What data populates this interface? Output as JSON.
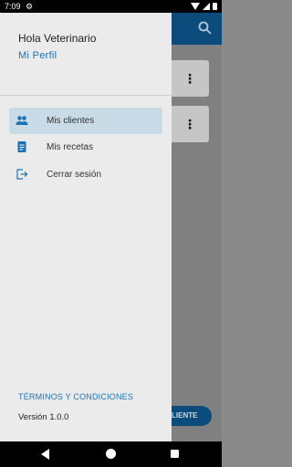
{
  "status_bar": {
    "time": "7:09"
  },
  "background": {
    "fab_label": "LIENTE"
  },
  "drawer": {
    "greeting": "Hola Veterinario",
    "profile_link": "Mi Perfil",
    "items": [
      {
        "label": "Mis clientes",
        "icon": "people-icon",
        "active": true
      },
      {
        "label": "Mis recetas",
        "icon": "document-icon",
        "active": false
      },
      {
        "label": "Cerrar sesión",
        "icon": "logout-icon",
        "active": false
      }
    ],
    "terms": "TÉRMINOS Y CONDICIONES",
    "version": "Versión 1.0.0"
  },
  "colors": {
    "accent": "#1a73b5",
    "primary": "#0b4c7c",
    "active_bg": "#c9dbe6"
  }
}
